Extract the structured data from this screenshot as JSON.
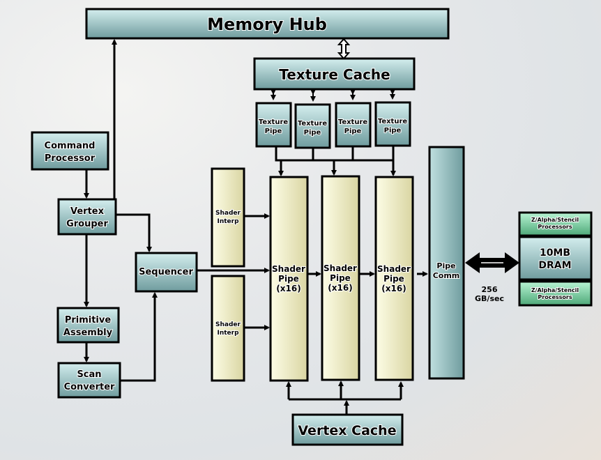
{
  "blocks": {
    "memory_hub": "Memory Hub",
    "texture_cache": "Texture Cache",
    "texture_pipe": [
      "Texture",
      "Pipe"
    ],
    "command_processor": [
      "Command",
      "Processor"
    ],
    "vertex_grouper": [
      "Vertex",
      "Grouper"
    ],
    "sequencer": "Sequencer",
    "primitive_assembly": [
      "Primitive",
      "Assembly"
    ],
    "scan_converter": [
      "Scan",
      "Converter"
    ],
    "shader_interp": [
      "Shader",
      "Interp"
    ],
    "shader_pipe": [
      "Shader",
      "Pipe",
      "(x16)"
    ],
    "pipe_comm": [
      "Pipe",
      "Comm"
    ],
    "zalpha": [
      "Z/Alpha/Stencil",
      "Processors"
    ],
    "dram": [
      "10MB",
      "DRAM"
    ],
    "vertex_cache": "Vertex Cache"
  },
  "bandwidth": [
    "256",
    "GB/sec"
  ],
  "colors": {
    "teal_top": "#d4eeee",
    "teal_bottom": "#6f9c9e",
    "cream_top": "#fdfde6",
    "cream_bottom": "#d9d5a2",
    "green_top": "#b8f4d4",
    "green_bottom": "#4ea878"
  }
}
